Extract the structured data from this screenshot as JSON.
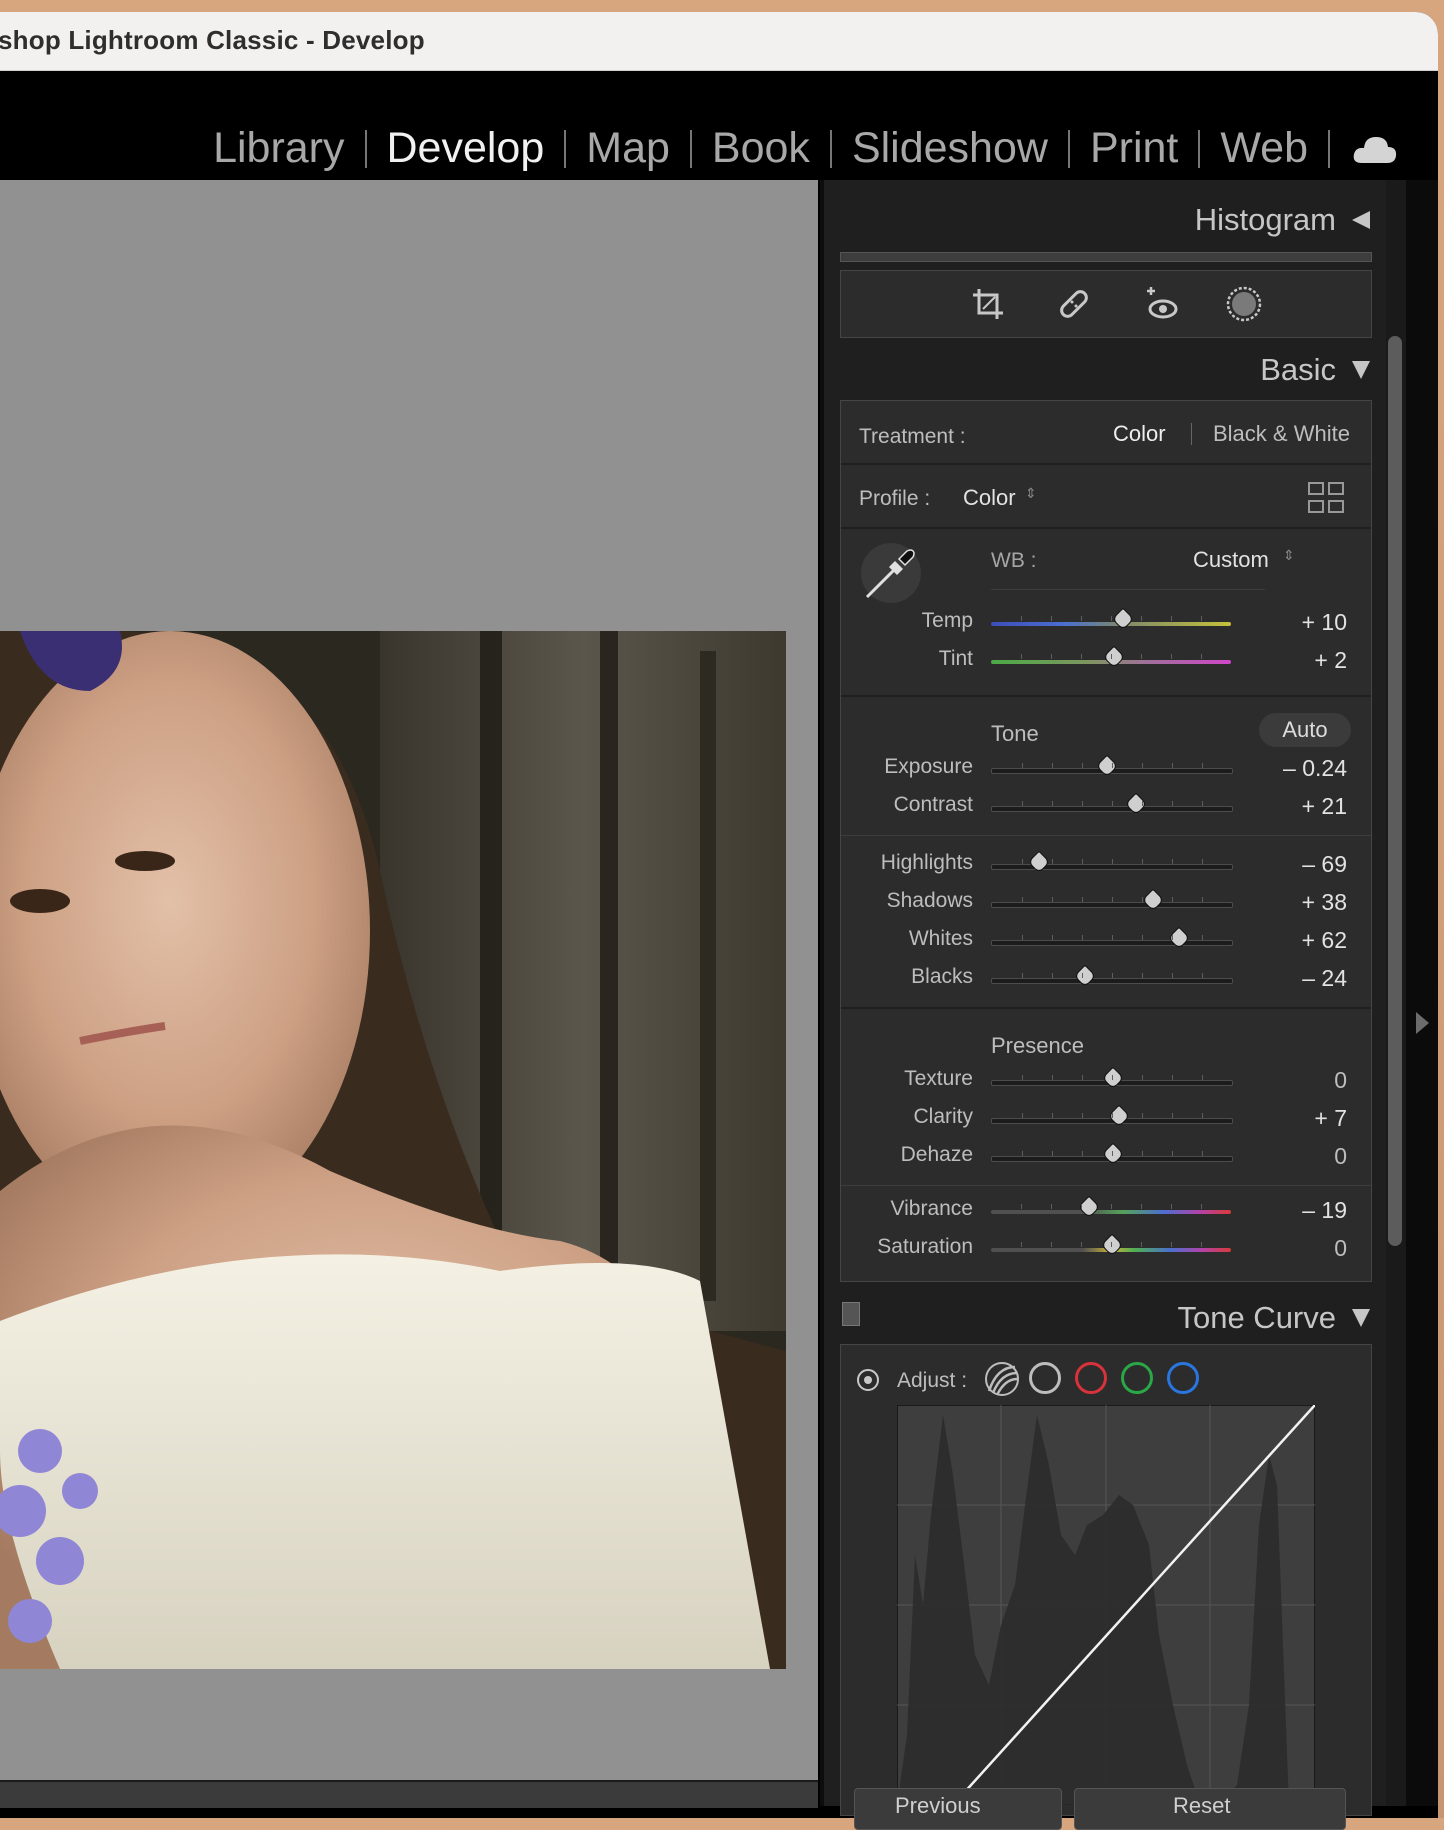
{
  "window": {
    "title": "shop Lightroom Classic - Develop"
  },
  "modules": [
    {
      "label": "Library",
      "active": false
    },
    {
      "label": "Develop",
      "active": true
    },
    {
      "label": "Map",
      "active": false
    },
    {
      "label": "Book",
      "active": false
    },
    {
      "label": "Slideshow",
      "active": false
    },
    {
      "label": "Print",
      "active": false
    },
    {
      "label": "Web",
      "active": false
    }
  ],
  "panels": {
    "histogram": "Histogram",
    "basic": "Basic",
    "tone_curve": "Tone Curve"
  },
  "basic": {
    "treatment_label": "Treatment :",
    "treatment_color": "Color",
    "treatment_bw": "Black & White",
    "profile_label": "Profile :",
    "profile_value": "Color",
    "wb_label": "WB :",
    "wb_value": "Custom",
    "tone_label": "Tone",
    "auto_label": "Auto",
    "presence_label": "Presence",
    "sliders": {
      "temp": {
        "label": "Temp",
        "value": "+ 10",
        "pos": 0.545
      },
      "tint": {
        "label": "Tint",
        "value": "+ 2",
        "pos": 0.51
      },
      "exposure": {
        "label": "Exposure",
        "value": "– 0.24",
        "pos": 0.476
      },
      "contrast": {
        "label": "Contrast",
        "value": "+ 21",
        "pos": 0.595
      },
      "highlights": {
        "label": "Highlights",
        "value": "– 69",
        "pos": 0.19
      },
      "shadows": {
        "label": "Shadows",
        "value": "+ 38",
        "pos": 0.665
      },
      "whites": {
        "label": "Whites",
        "value": "+ 62",
        "pos": 0.775
      },
      "blacks": {
        "label": "Blacks",
        "value": "– 24",
        "pos": 0.385
      },
      "texture": {
        "label": "Texture",
        "value": "0",
        "pos": 0.5
      },
      "clarity": {
        "label": "Clarity",
        "value": "+ 7",
        "pos": 0.525
      },
      "dehaze": {
        "label": "Dehaze",
        "value": "0",
        "pos": 0.5
      },
      "vibrance": {
        "label": "Vibrance",
        "value": "– 19",
        "pos": 0.405
      },
      "saturation": {
        "label": "Saturation",
        "value": "0",
        "pos": 0.5
      }
    }
  },
  "tone_curve": {
    "adjust_label": "Adjust :",
    "channels": [
      "parametric",
      "rgb",
      "red",
      "green",
      "blue"
    ],
    "colors": {
      "red": "#d8323a",
      "green": "#2aa746",
      "blue": "#2a76e0",
      "rgb": "#bdbdbd"
    }
  },
  "buttons": {
    "previous": "Previous",
    "reset": "Reset"
  }
}
